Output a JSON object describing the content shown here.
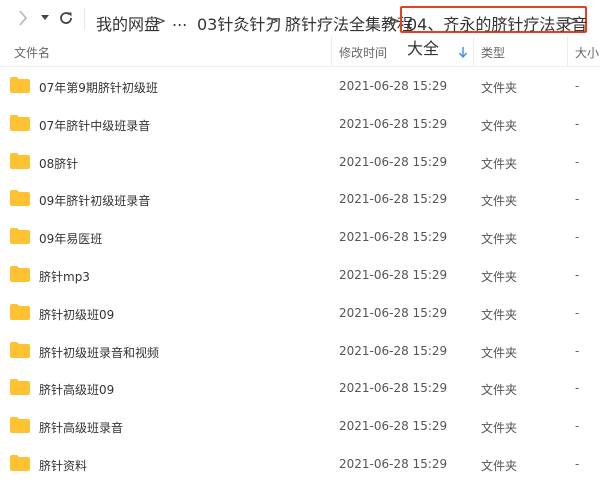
{
  "toolbar": {
    "forward_icon": "chevron-right-icon",
    "dropdown_icon": "caret-down-icon",
    "refresh_icon": "refresh-icon"
  },
  "breadcrumb": {
    "items": [
      "我的网盘",
      "...",
      "03针灸针刀",
      "脐针疗法全集教程",
      "04、齐永的脐针疗法录音大全"
    ],
    "separator": ">",
    "highlight_color": "#e2431e"
  },
  "columns": {
    "name": "文件名",
    "modified": "修改时间",
    "type": "类型",
    "size": "大小"
  },
  "folder_color": "#ffc233",
  "sort_color": "#3b8cf0",
  "files": [
    {
      "name": "07年第9期脐针初级班",
      "modified": "2021-06-28 15:29",
      "type": "文件夹",
      "size": "-"
    },
    {
      "name": "07年脐针中级班录音",
      "modified": "2021-06-28 15:29",
      "type": "文件夹",
      "size": "-"
    },
    {
      "name": "08脐针",
      "modified": "2021-06-28 15:29",
      "type": "文件夹",
      "size": "-"
    },
    {
      "name": "09年脐针初级班录音",
      "modified": "2021-06-28 15:29",
      "type": "文件夹",
      "size": "-"
    },
    {
      "name": "09年易医班",
      "modified": "2021-06-28 15:29",
      "type": "文件夹",
      "size": "-"
    },
    {
      "name": "脐针mp3",
      "modified": "2021-06-28 15:29",
      "type": "文件夹",
      "size": "-"
    },
    {
      "name": "脐针初级班09",
      "modified": "2021-06-28 15:29",
      "type": "文件夹",
      "size": "-"
    },
    {
      "name": "脐针初级班录音和视频",
      "modified": "2021-06-28 15:29",
      "type": "文件夹",
      "size": "-"
    },
    {
      "name": "脐针高级班09",
      "modified": "2021-06-28 15:29",
      "type": "文件夹",
      "size": "-"
    },
    {
      "name": "脐针高级班录音",
      "modified": "2021-06-28 15:29",
      "type": "文件夹",
      "size": "-"
    },
    {
      "name": "脐针资料",
      "modified": "2021-06-28 15:29",
      "type": "文件夹",
      "size": "-"
    }
  ]
}
